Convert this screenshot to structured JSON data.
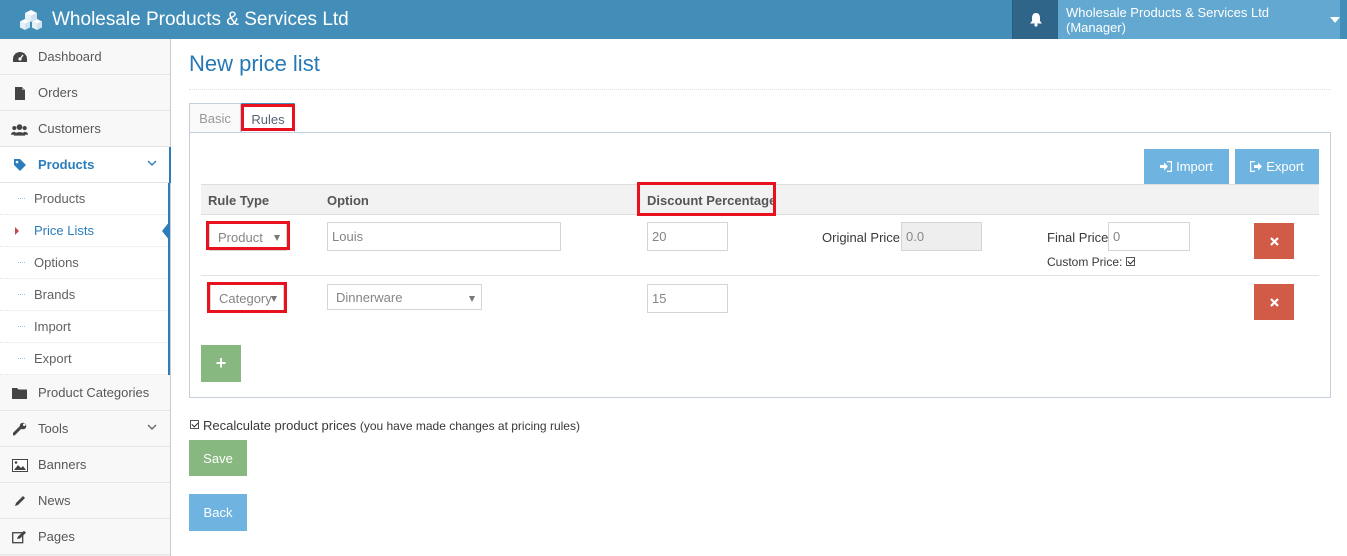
{
  "topbar": {
    "brand": "Wholesale Products & Services Ltd",
    "user": "Wholesale Products & Services Ltd (Manager)"
  },
  "sidebar": {
    "items": [
      {
        "label": "Dashboard",
        "icon": "dashboard-icon"
      },
      {
        "label": "Orders",
        "icon": "file-icon"
      },
      {
        "label": "Customers",
        "icon": "users-icon"
      },
      {
        "label": "Products",
        "icon": "tag-icon",
        "active": true
      },
      {
        "label": "Product Categories",
        "icon": "folder-icon"
      },
      {
        "label": "Tools",
        "icon": "wrench-icon"
      },
      {
        "label": "Banners",
        "icon": "picture-icon"
      },
      {
        "label": "News",
        "icon": "pencil-icon"
      },
      {
        "label": "Pages",
        "icon": "edit-icon"
      }
    ],
    "products_submenu": [
      "Products",
      "Price Lists",
      "Options",
      "Brands",
      "Import",
      "Export"
    ]
  },
  "main": {
    "title": "New price list",
    "tabs": [
      "Basic",
      "Rules"
    ],
    "active_tab": "Rules",
    "import_label": "Import",
    "export_label": "Export",
    "columns": [
      "Rule Type",
      "Option",
      "Discount Percentage"
    ],
    "rows": [
      {
        "rule_type": "Product",
        "option": "Louis",
        "discount": "20",
        "original_price_label": "Original Price:",
        "original_price": "0.0",
        "final_price_label": "Final Price:",
        "final_price": "0",
        "custom_price_label": "Custom Price:"
      },
      {
        "rule_type": "Category",
        "option": "Dinnerware",
        "discount": "15"
      }
    ],
    "add_label": "+",
    "recalculate_label": "Recalculate product prices",
    "recalculate_note": "(you have made changes at pricing rules)",
    "save_label": "Save",
    "back_label": "Back"
  },
  "colors": {
    "topbar": "#438eb9",
    "accent": "#2b7dbc",
    "highlight": "#e8111e",
    "danger": "#d15b47",
    "success": "#87b87f",
    "info": "#6fb3e0"
  }
}
